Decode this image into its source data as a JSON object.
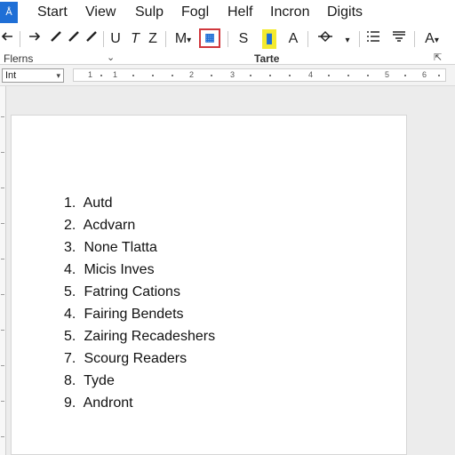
{
  "app": {
    "icon_text": "Å"
  },
  "menu": [
    {
      "label": "Start"
    },
    {
      "label": "View"
    },
    {
      "label": "Sulp"
    },
    {
      "label": "Fogl"
    },
    {
      "label": "Helf"
    },
    {
      "label": "Incron"
    },
    {
      "label": "Digits"
    }
  ],
  "toolbar": {
    "icons": [
      "arrow-left-icon",
      "arrow-right-icon",
      "pen-icon",
      "pen-icon",
      "pen-icon",
      "underline-icon",
      "italic-icon",
      "strikethrough-icon",
      "macro-icon",
      "table-icon",
      "style-icon",
      "highlight-icon",
      "font-color-icon",
      "insert-icon",
      "list-icon",
      "align-icon",
      "text-effects-icon"
    ],
    "underline_label": "U",
    "italic_label": "T",
    "z_label": "Z",
    "macro_label": "M",
    "s_label": "S",
    "a_label": "A",
    "effects_label": "A",
    "table_button_color": "#d0383d",
    "highlight_color": "#f3ea2f"
  },
  "ribbon_groups": {
    "left_label": "Flerns",
    "center_label": "Tarte"
  },
  "style_box": {
    "value": "Int"
  },
  "ruler_numbers": [
    "1",
    "1",
    "2",
    "3",
    "4",
    "5",
    "6"
  ],
  "document": {
    "list_items": [
      {
        "num": "1.",
        "text": "Autd"
      },
      {
        "num": "2.",
        "text": "Acdvarn"
      },
      {
        "num": "3.",
        "text": "None Tlatta"
      },
      {
        "num": "4.",
        "text": "Micis Inves"
      },
      {
        "num": "5.",
        "text": "Fatring Cations"
      },
      {
        "num": "4.",
        "text": "Fairing Bendets"
      },
      {
        "num": "5.",
        "text": "Zairing Recadeshers"
      },
      {
        "num": "7.",
        "text": "Scourg Readers"
      },
      {
        "num": "8.",
        "text": "Tyde"
      },
      {
        "num": "9.",
        "text": "Andront"
      }
    ]
  }
}
